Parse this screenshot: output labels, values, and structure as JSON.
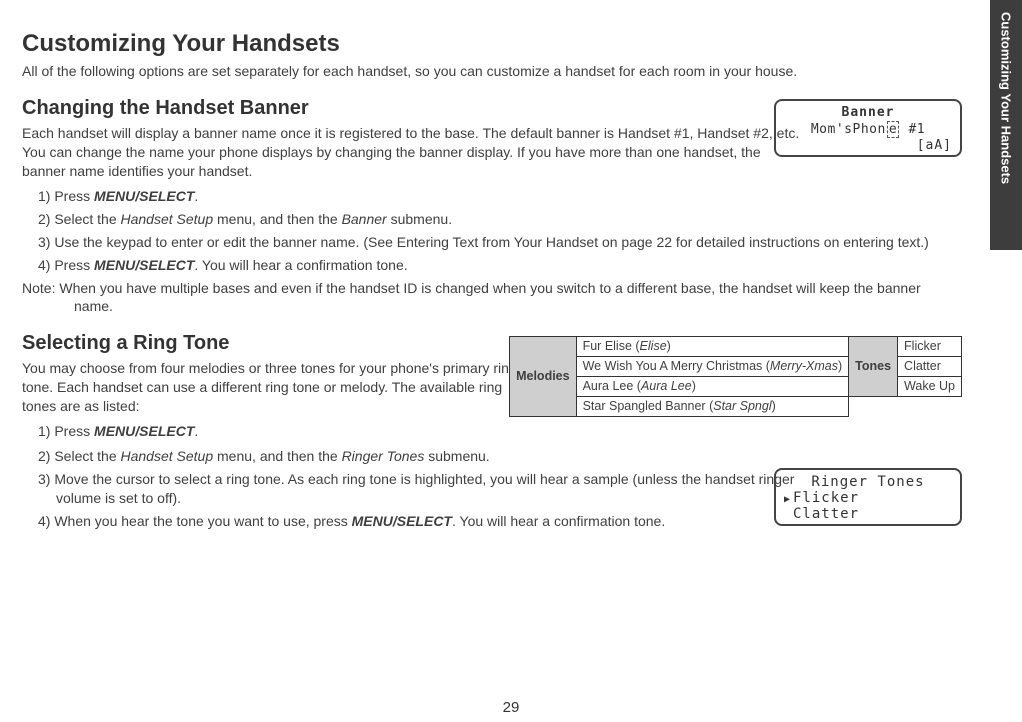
{
  "sideTab": "Customizing Your Handsets",
  "h1": "Customizing Your Handsets",
  "intro": "All of the following options are set separately for each handset, so you can customize a handset for each room in your house.",
  "h2a": "Changing the Handset Banner",
  "bannerPara": "Each handset will display a banner name once it is registered to the base. The default banner is Handset #1, Handset #2, etc. You can change the name your phone displays by changing the banner display. If you have more than one handset, the banner name identifies your handset.",
  "lcdBanner": {
    "line1": "Banner",
    "line2a": "Mom'sPhon",
    "line2cursor": "e",
    "line2b": " #1",
    "line3": "[aA]"
  },
  "steps1": {
    "s1a": "Press ",
    "s1b": "MENU/SELECT",
    "s1c": ".",
    "s2a": "Select the ",
    "s2b": "Handset Setup",
    "s2c": " menu, and then the ",
    "s2d": "Banner",
    "s2e": " submenu.",
    "s3": "Use the keypad to enter or edit the banner name. (See Entering Text from Your Handset on page 22 for detailed instructions on entering text.)",
    "s4a": "Press ",
    "s4b": "MENU/SELECT",
    "s4c": ". You will hear a confirmation tone."
  },
  "noteLabel": "Note:  ",
  "noteText": "When you have multiple bases and even if the handset ID is changed when you switch to a different base, the handset will keep the banner name.",
  "h2b": "Selecting a Ring Tone",
  "ringIntro": "You may choose from four melodies or three tones for your phone's primary ring tone. Each handset can use a different ring tone or melody. The available ring tones are as listed:",
  "table": {
    "melodiesHdr": "Melodies",
    "tonesHdr": "Tones",
    "m1a": "Fur Elise (",
    "m1b": "Elise",
    "m1c": ")",
    "m2a": "We Wish You A Merry Christmas (",
    "m2b": "Merry-Xmas",
    "m2c": ")",
    "m3a": "Aura Lee (",
    "m3b": "Aura Lee",
    "m3c": ")",
    "m4a": "Star Spangled Banner (",
    "m4b": "Star Spngl",
    "m4c": ")",
    "t1": "Flicker",
    "t2": "Clatter",
    "t3": "Wake Up"
  },
  "steps2": {
    "s1a": "Press ",
    "s1b": "MENU/SELECT",
    "s1c": ".",
    "s2a": "Select the ",
    "s2b": "Handset Setup",
    "s2c": " menu, and then the ",
    "s2d": "Ringer Tones",
    "s2e": " submenu.",
    "s3": "Move the cursor to select a ring tone. As each ring tone is highlighted, you will hear a sample (unless the handset ringer volume is set to off).",
    "s4a": "When you hear the tone you want to use, press ",
    "s4b": "MENU/SELECT",
    "s4c": ". You will hear a confirmation tone."
  },
  "lcdRinger": {
    "title": "Ringer Tones",
    "row1": "Flicker",
    "row2": "Clatter"
  },
  "pageNum": "29"
}
